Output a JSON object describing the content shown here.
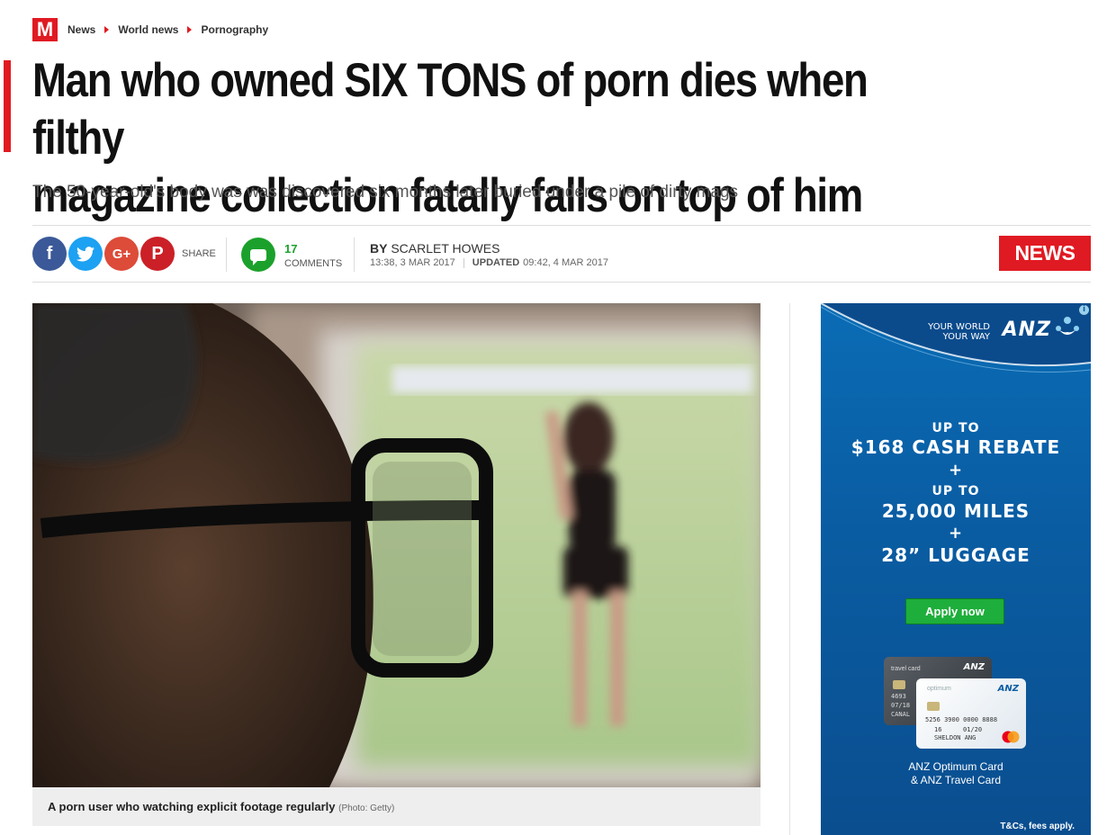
{
  "breadcrumb": {
    "logo": "M",
    "items": [
      "News",
      "World news",
      "Pornography"
    ]
  },
  "article": {
    "headline_line1": "Man who owned SIX TONS of porn dies when filthy",
    "headline_line2": "magazine collection fatally falls on top of him",
    "standfirst": "The 50-year-old's body was was discovered six months later buried under a pile of dirty mags"
  },
  "meta": {
    "share_label": "SHARE",
    "social_icons": [
      "facebook-icon",
      "twitter-icon",
      "google-plus-icon",
      "pinterest-icon"
    ],
    "social_glyphs": {
      "facebook": "f",
      "twitter": "t",
      "googleplus": "G+",
      "pinterest": "P"
    },
    "comment_count": "17",
    "comments_label": "COMMENTS",
    "by_label": "BY",
    "author": "SCARLET HOWES",
    "published": "13:38, 3 MAR 2017",
    "updated_label": "UPDATED",
    "updated": "09:42, 4 MAR 2017",
    "section_badge": "NEWS"
  },
  "image": {
    "caption": "A porn user who watching explicit footage regularly",
    "credit": "(Photo: Getty)"
  },
  "ad": {
    "tagline_line1": "YOUR WORLD",
    "tagline_line2": "YOUR WAY",
    "brand": "ANZ",
    "info": "i",
    "lines": [
      "UP TO",
      "$168 CASH REBATE",
      "+",
      "UP TO",
      "25,000 MILES",
      "+",
      "28” LUGGAGE"
    ],
    "cta": "Apply now",
    "card1_label": "travel card",
    "card1_number": "4693",
    "card1_expiry": "07/18",
    "card1_name": "CANAL",
    "card2_label": "optimum",
    "card2_number": "5256 3900 0000 8888",
    "card2_valid_from": "16",
    "card2_valid_to": "01/20",
    "card2_name": "SHELDON ANG",
    "card2_network": "MasterCard",
    "product_line1": "ANZ Optimum Card",
    "product_line2": "& ANZ Travel Card",
    "tcs": "T&Cs, fees apply."
  },
  "colors": {
    "brand_red": "#e01a22",
    "comment_green": "#1ba12b",
    "ad_blue": "#0a5da3",
    "facebook": "#3b5998",
    "twitter": "#1da1f2",
    "googleplus": "#dd4b39",
    "pinterest": "#cb2027"
  }
}
